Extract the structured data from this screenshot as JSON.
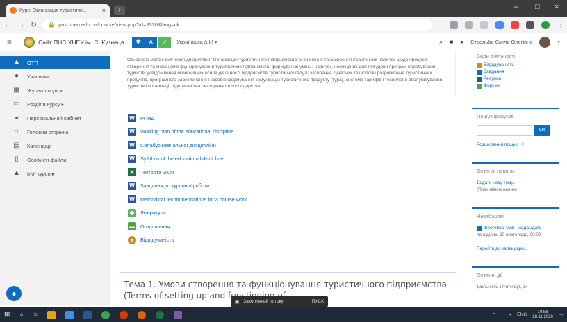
{
  "browser": {
    "tab_title": "Курс: Організація туристичн...",
    "tab_close": "×",
    "new_tab": "+",
    "url": "pns.hneu.edu.ua/course/view.php?id=3330&lang=uk",
    "win_min": "–",
    "win_max": "□",
    "win_close": "×"
  },
  "navbar": {
    "site_name": "Сайт ПНС ХНЕУ ім. С. Кузнеця",
    "language": "Українська (uk) ▾",
    "user_name": "Стрельба Сміла Олегівна"
  },
  "drawer": {
    "items": [
      {
        "label": "ОТП",
        "icon": "graduation-cap-icon"
      },
      {
        "label": "Учасники",
        "icon": "users-icon"
      },
      {
        "label": "Журнал оцінок",
        "icon": "table-icon"
      },
      {
        "label": "Розділи курсу ▸",
        "icon": "folder-icon"
      },
      {
        "label": "Персональний кабінет",
        "icon": "dashboard-icon"
      },
      {
        "label": "Головна сторінка",
        "icon": "home-icon"
      },
      {
        "label": "Календар",
        "icon": "calendar-icon"
      },
      {
        "label": "Особисті файли",
        "icon": "file-icon"
      },
      {
        "label": "Мої курси ▸",
        "icon": "graduation-cap-icon"
      }
    ]
  },
  "main": {
    "description": "Основною метою вивчення дисципліни \"Організація туристичного підприємства\" є вивчення та засвоєння практичних навичок щодо процесів створення та механізмів функціонування туристичних підприємств, формування умінь і навичок, необхідних для побудови програм перебування туристів; усвідомлення економічних основ діяльності підприємств туристичної галузі; засвоєння сучасних технологій розроблення туристичних продуктів, програмного забезпечення і засобів формування комунікацій туристичного продукту (тура), система тарифів і технологія обслуговування туристів і організації підприємства ресторанного господарства.",
    "resources": [
      {
        "label": "РПНД",
        "icon": "word-icon"
      },
      {
        "label": "Working plan of the educational discipline",
        "icon": "word-icon"
      },
      {
        "label": "Силабус навчальної дисципліни",
        "icon": "word-icon"
      },
      {
        "label": "Syllabus of the educational discipline",
        "icon": "word-icon"
      },
      {
        "label": "Текторта 2020",
        "icon": "excel-icon"
      },
      {
        "label": "Завдання до курсової роботи",
        "icon": "word-icon"
      },
      {
        "label": "Methodical recommendations for a course work",
        "icon": "word-icon"
      },
      {
        "label": "Література",
        "icon": "book-icon"
      },
      {
        "label": "Оголошення",
        "icon": "forum-icon"
      },
      {
        "label": "Відвідуваність",
        "icon": "attendance-icon"
      }
    ],
    "topic_title": "Тема 1. Умови створення та функціонування туристичного підприємства (Terms of setting up and functioning of"
  },
  "right": {
    "activities_title": "Види діяльності",
    "activities": [
      {
        "label": "Відвідуваність",
        "color": "#d58c1f"
      },
      {
        "label": "Завдання",
        "color": "#0f6cbf"
      },
      {
        "label": "Ресурси",
        "color": "#2b5797"
      },
      {
        "label": "Форуми",
        "color": "#4aa54a"
      }
    ],
    "search_title": "Пошук форумів",
    "search_button": "Ок",
    "advanced_search": "Розширений пошук",
    "news_title": "Останні новини",
    "news_add": "Додати нову тему...",
    "news_empty": "(Поки ніяких новин)",
    "upcoming_title": "Незабаром",
    "upcoming_item": "theoretical task - нада здать",
    "upcoming_date": "понеділок, 30 листопада, 00:00",
    "calendar_link": "Перейти до календаря...",
    "recent_title": "Останні дії",
    "recent_text": "Діяльність з п'ятниця, 27"
  },
  "chat": {
    "label": "Захоплений потоку",
    "action": "ПУСК"
  },
  "taskbar": {
    "lang": "ENG",
    "time": "10:58",
    "date": "28.11.2020"
  }
}
